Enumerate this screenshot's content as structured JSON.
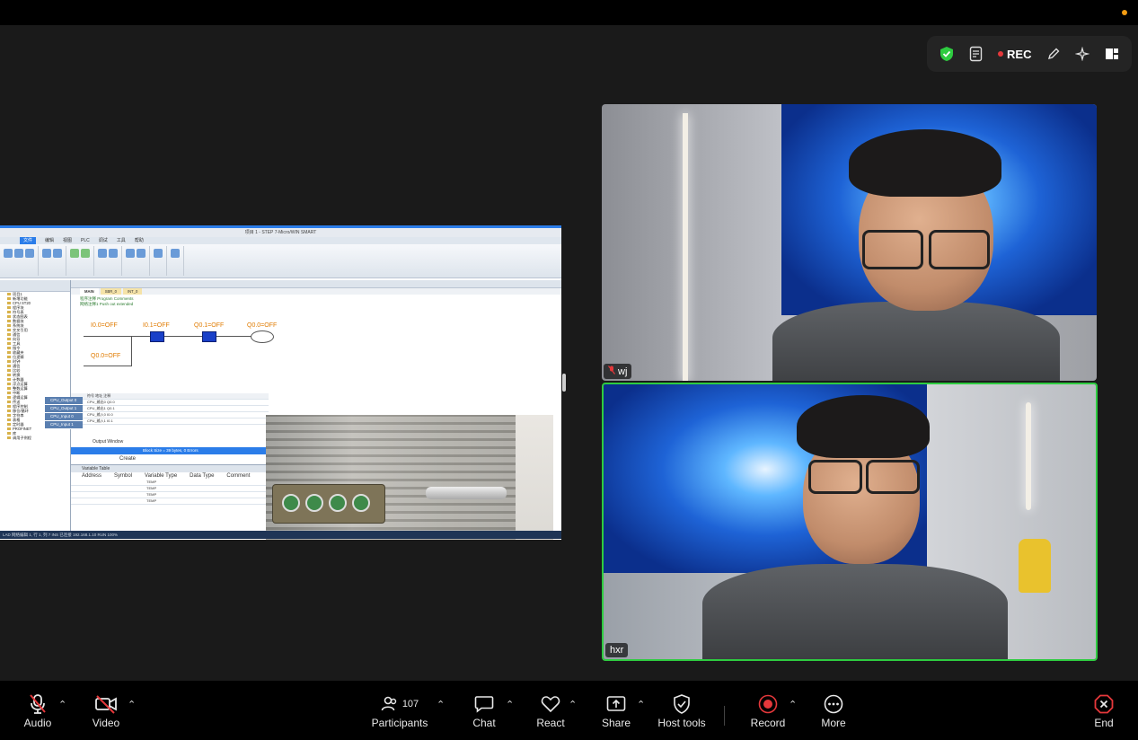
{
  "top_tools": {
    "rec_label": "REC"
  },
  "shared_screen": {
    "window_title": "项目 1 - STEP 7-Micro/WIN SMART",
    "menu": [
      "文件",
      "编辑",
      "视图",
      "PLC",
      "调试",
      "工具",
      "帮助"
    ],
    "editor_tabs": [
      "MAIN",
      "SBR_0",
      "INT_0"
    ],
    "program_comments": "程序注释  Program Comments",
    "network_comment": "网络注释1  Push out extended",
    "ladder": {
      "contact_1": "I0.0=OFF",
      "contact_2": "I0.1=OFF",
      "contact_3": "Q0.1=OFF",
      "coil": "Q0.0=OFF",
      "parallel": "Q0.0=OFF"
    },
    "tree_items": [
      "项目1",
      "新增功能",
      "CPU ST20",
      "程序块",
      "符号表",
      "状态图表",
      "数据块",
      "系统块",
      "交叉引用",
      "通信",
      "向导",
      "工具",
      "指令",
      "收藏夹",
      "位逻辑",
      "时钟",
      "通信",
      "比较",
      "转换",
      "计数器",
      "浮点运算",
      "整数运算",
      "中断",
      "逻辑运算",
      "传送",
      "程序控制",
      "移位/循环",
      "字符串",
      "表格",
      "定时器",
      "PROFINET",
      "库",
      "调用子例程"
    ],
    "symbol_callouts": [
      "CPU_Output 0",
      "CPU_Output 1",
      "CPU_Input 0",
      "CPU_Input 1"
    ],
    "output_window": "Output Window",
    "output_line": "Block Size = 39 bytes, 0 Errors",
    "create_label": "Create",
    "variable_table": {
      "title": "Variable Table",
      "columns": [
        "Address",
        "Symbol",
        "Variable Type",
        "Data Type",
        "Comment"
      ],
      "rows": [
        "TEMP",
        "TEMP",
        "TEMP",
        "TEMP"
      ]
    },
    "status_bar": "LAD 网络编辑 1, 行 1, 列 7    INS    已连接 192.168.1.10    RUN    100%"
  },
  "participants": [
    {
      "name": "wj",
      "muted": true
    },
    {
      "name": "hxr",
      "muted": false,
      "active_speaker": true
    }
  ],
  "toolbar": {
    "audio": "Audio",
    "video": "Video",
    "participants": "Participants",
    "participant_count": "107",
    "chat": "Chat",
    "react": "React",
    "share": "Share",
    "host_tools": "Host tools",
    "record": "Record",
    "more": "More",
    "end": "End"
  },
  "colors": {
    "record_red": "#e5383b",
    "active_speaker_border": "#2ecc40",
    "shield_green": "#2ecc40",
    "end_red": "#e5383b"
  }
}
